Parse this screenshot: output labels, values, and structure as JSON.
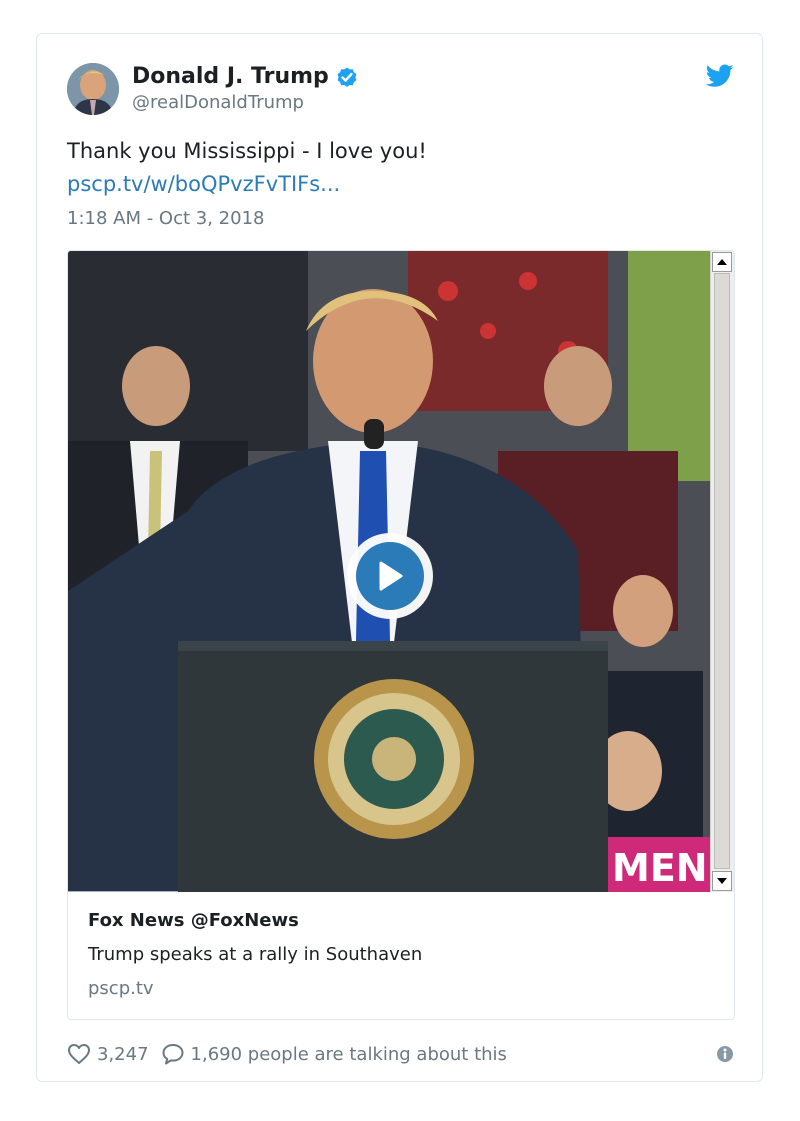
{
  "author": {
    "name": "Donald J. Trump",
    "handle": "@realDonaldTrump",
    "verified_icon": "verified-badge-icon"
  },
  "tweet": {
    "text": "Thank you Mississippi - I love you!",
    "link": "pscp.tv/w/boQPvzFvTIFs...",
    "timestamp": "1:18 AM - Oct 3, 2018"
  },
  "media_card": {
    "overlay_text": "MEN",
    "title": "Fox News @FoxNews",
    "description": "Trump speaks at a rally in Southaven",
    "domain": "pscp.tv"
  },
  "footer": {
    "like_count": "3,247",
    "talking_text": "1,690 people are talking about this"
  },
  "colors": {
    "link": "#2b7bb9",
    "twitter_blue": "#1da1f2",
    "muted_text": "#697882",
    "border": "#e1e8ed"
  }
}
